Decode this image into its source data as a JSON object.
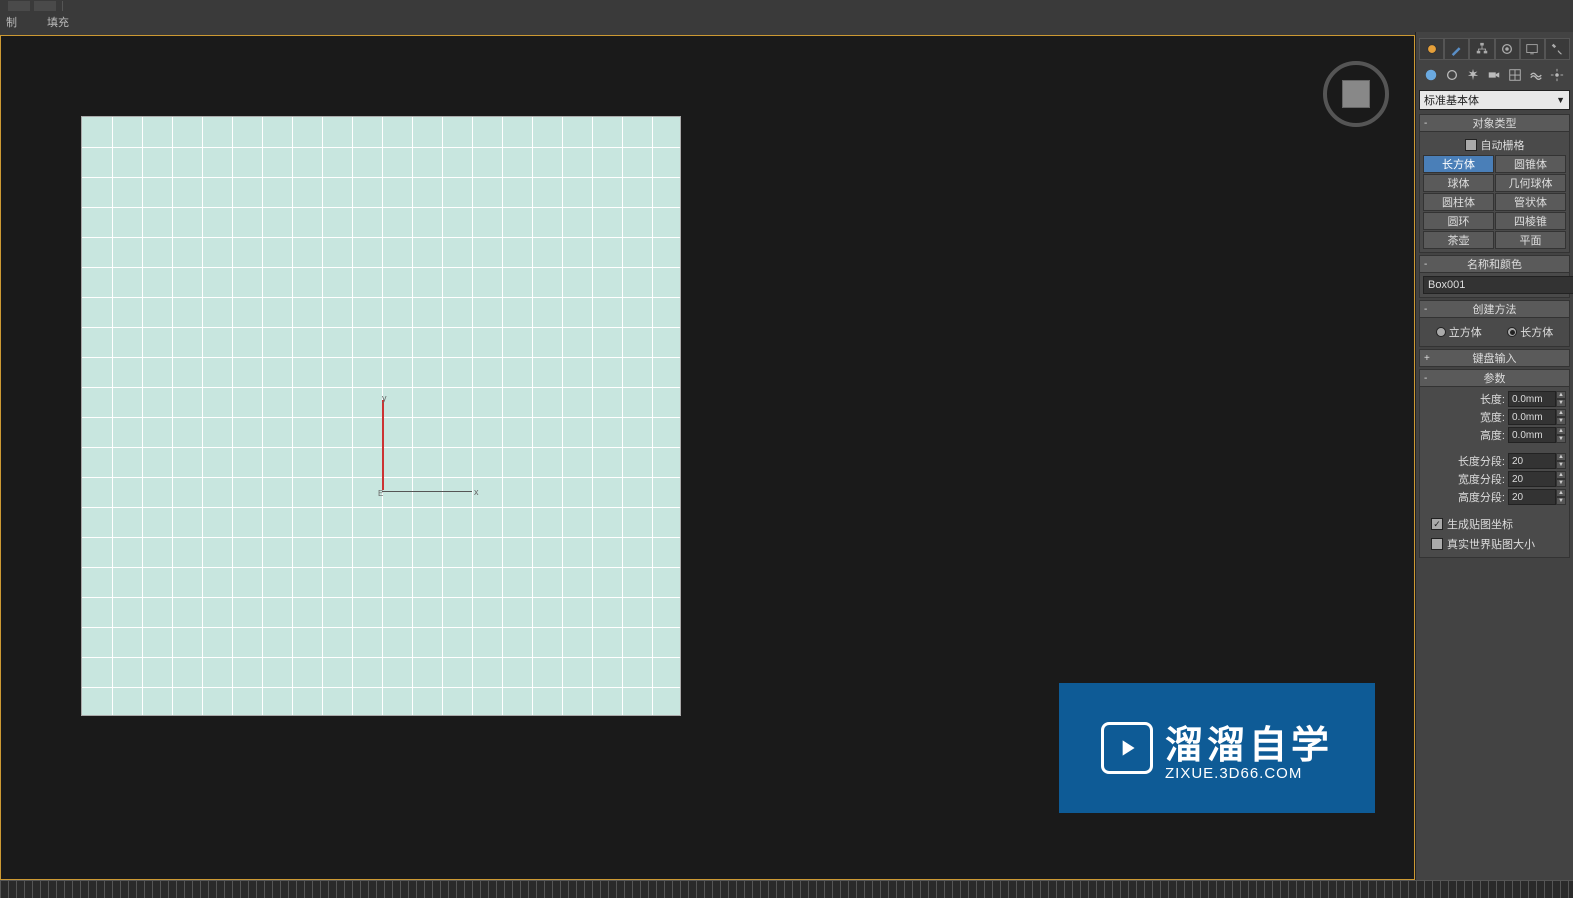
{
  "menu": {
    "item1": "制",
    "item2": "填充"
  },
  "viewport": {
    "axis_x": "x",
    "axis_y": "y",
    "axis_e": "E"
  },
  "panel": {
    "category_dropdown": "标准基本体",
    "rollouts": {
      "object_type": {
        "title": "对象类型",
        "auto_grid": "自动栅格"
      },
      "name_color": {
        "title": "名称和颜色"
      },
      "creation_method": {
        "title": "创建方法",
        "cube": "立方体",
        "box": "长方体"
      },
      "keyboard_entry": {
        "title": "键盘输入"
      },
      "parameters": {
        "title": "参数"
      }
    },
    "buttons": {
      "box": "长方体",
      "cone": "圆锥体",
      "sphere": "球体",
      "geosphere": "几何球体",
      "cylinder": "圆柱体",
      "tube": "管状体",
      "torus": "圆环",
      "pyramid": "四棱锥",
      "teapot": "茶壶",
      "plane": "平面"
    },
    "object_name": "Box001",
    "params": {
      "length_label": "长度:",
      "length_val": "0.0mm",
      "width_label": "宽度:",
      "width_val": "0.0mm",
      "height_label": "高度:",
      "height_val": "0.0mm",
      "length_segs_label": "长度分段:",
      "length_segs_val": "20",
      "width_segs_label": "宽度分段:",
      "width_segs_val": "20",
      "height_segs_label": "高度分段:",
      "height_segs_val": "20",
      "gen_map_coords": "生成贴图坐标",
      "real_world_map": "真实世界贴图大小"
    }
  },
  "watermark": {
    "main": "溜溜自学",
    "sub": "ZIXUE.3D66.COM"
  }
}
